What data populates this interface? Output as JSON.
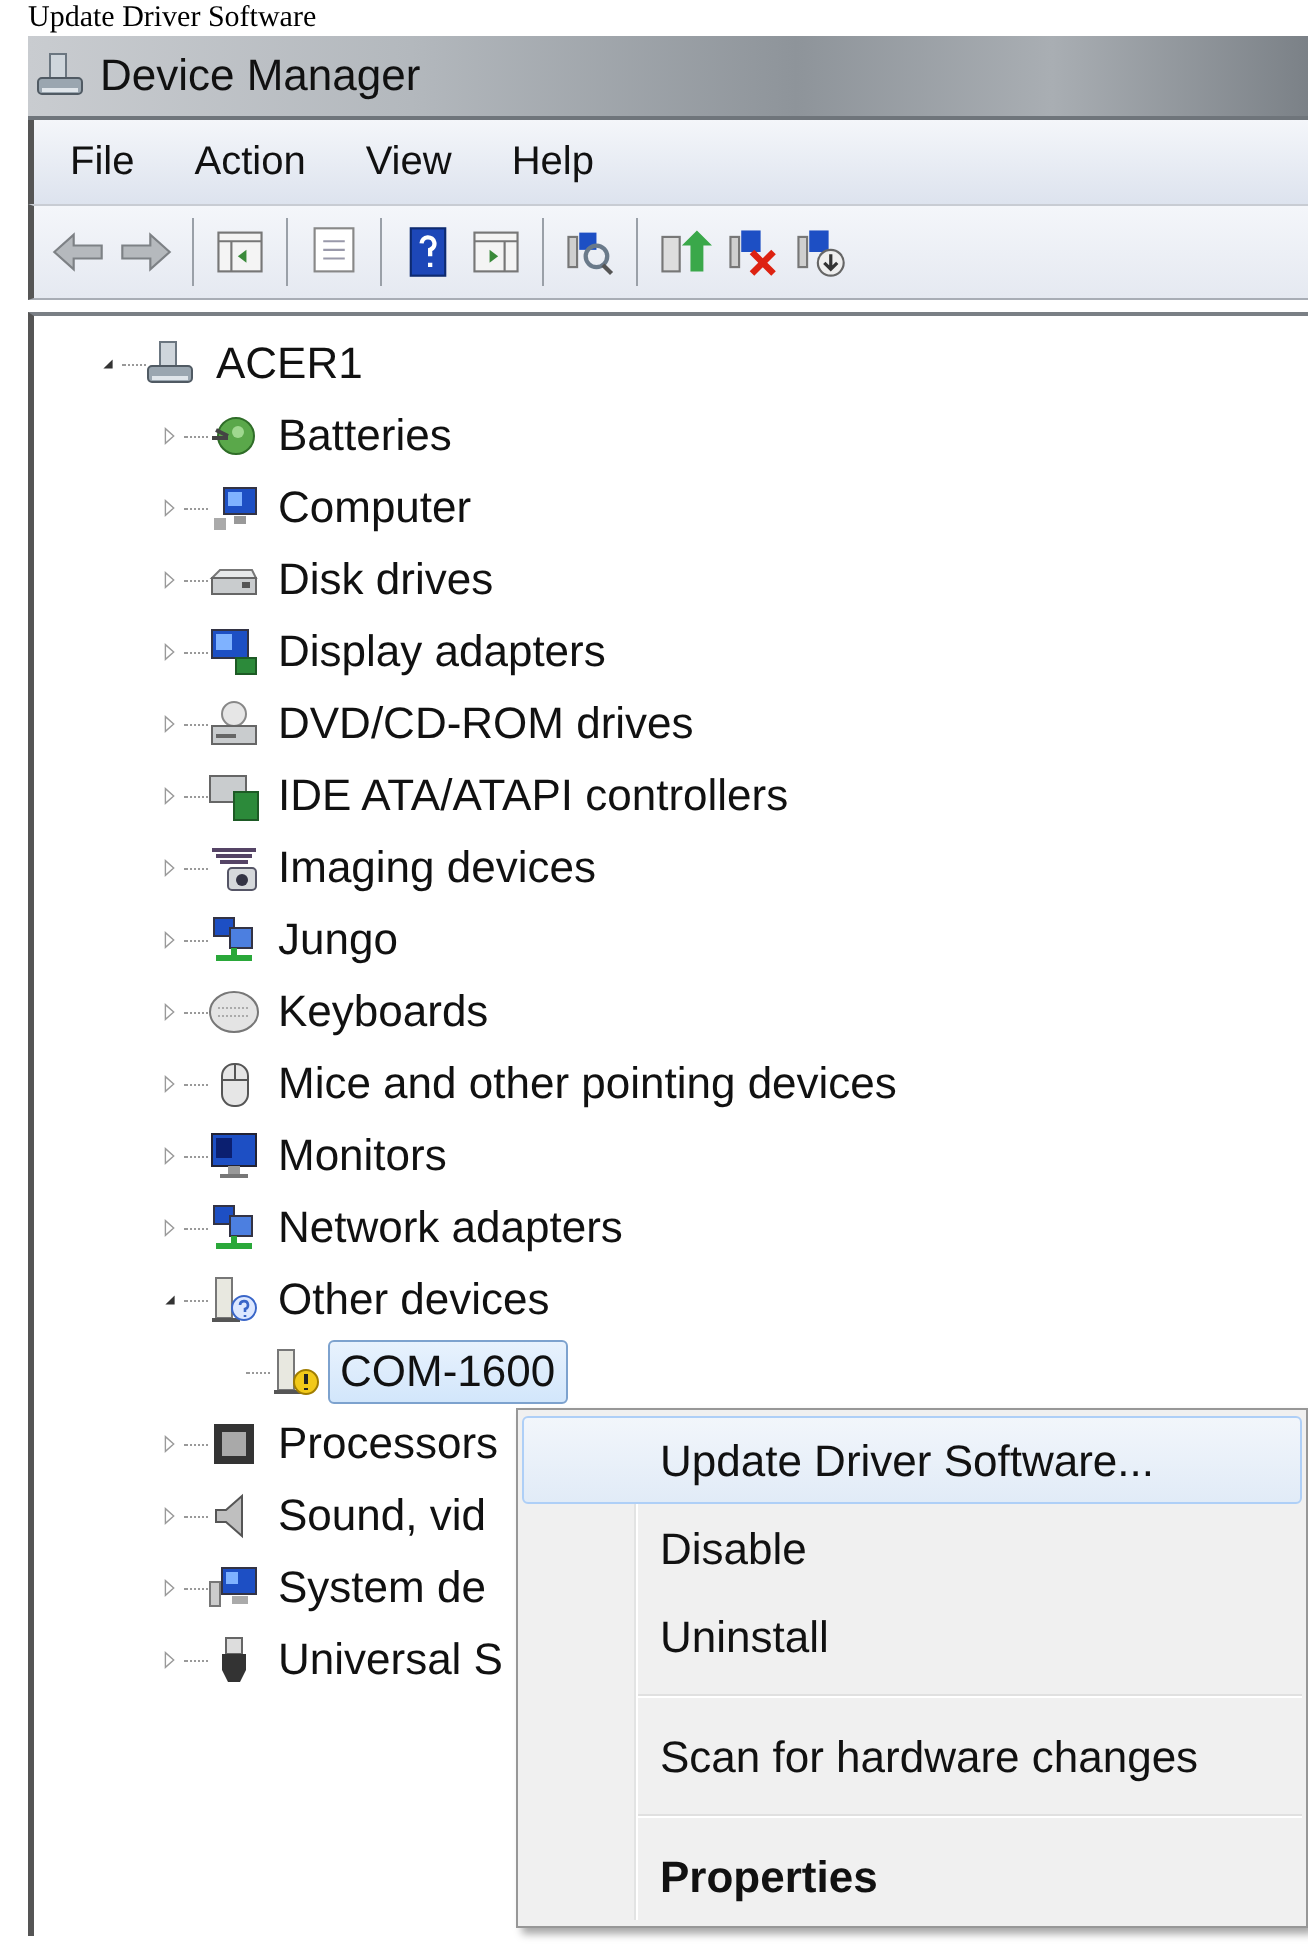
{
  "caption": "Update Driver Software",
  "window": {
    "title": "Device Manager"
  },
  "menu_bar": [
    "File",
    "Action",
    "View",
    "Help"
  ],
  "tree": [
    {
      "label": "ACER1",
      "expanded": true,
      "selected": false,
      "children": [
        {
          "label": "Batteries",
          "expanded": false,
          "selected": false
        },
        {
          "label": "Computer",
          "expanded": false,
          "selected": false
        },
        {
          "label": "Disk drives",
          "expanded": false,
          "selected": false
        },
        {
          "label": "Display adapters",
          "expanded": false,
          "selected": false
        },
        {
          "label": "DVD/CD-ROM drives",
          "expanded": false,
          "selected": false
        },
        {
          "label": "IDE ATA/ATAPI controllers",
          "expanded": false,
          "selected": false
        },
        {
          "label": "Imaging devices",
          "expanded": false,
          "selected": false
        },
        {
          "label": "Jungo",
          "expanded": false,
          "selected": false
        },
        {
          "label": "Keyboards",
          "expanded": false,
          "selected": false
        },
        {
          "label": "Mice and other pointing devices",
          "expanded": false,
          "selected": false
        },
        {
          "label": "Monitors",
          "expanded": false,
          "selected": false
        },
        {
          "label": "Network adapters",
          "expanded": false,
          "selected": false
        },
        {
          "label": "Other devices",
          "expanded": true,
          "selected": false,
          "children": [
            {
              "label": "COM-1600",
              "selected": true
            }
          ]
        },
        {
          "label": "Processors",
          "expanded": false,
          "selected": false
        },
        {
          "label": "Sound, vid",
          "expanded": false,
          "selected": false
        },
        {
          "label": "System de",
          "expanded": false,
          "selected": false
        },
        {
          "label": "Universal S",
          "expanded": false,
          "selected": false
        }
      ]
    }
  ],
  "context_menu": [
    {
      "kind": "item",
      "label": "Update Driver Software...",
      "highlighted": true,
      "default": false
    },
    {
      "kind": "item",
      "label": "Disable",
      "highlighted": false,
      "default": false
    },
    {
      "kind": "item",
      "label": "Uninstall",
      "highlighted": false,
      "default": false
    },
    {
      "kind": "separator"
    },
    {
      "kind": "item",
      "label": "Scan for hardware changes",
      "highlighted": false,
      "default": false
    },
    {
      "kind": "separator"
    },
    {
      "kind": "item",
      "label": "Properties",
      "highlighted": false,
      "default": true
    }
  ]
}
